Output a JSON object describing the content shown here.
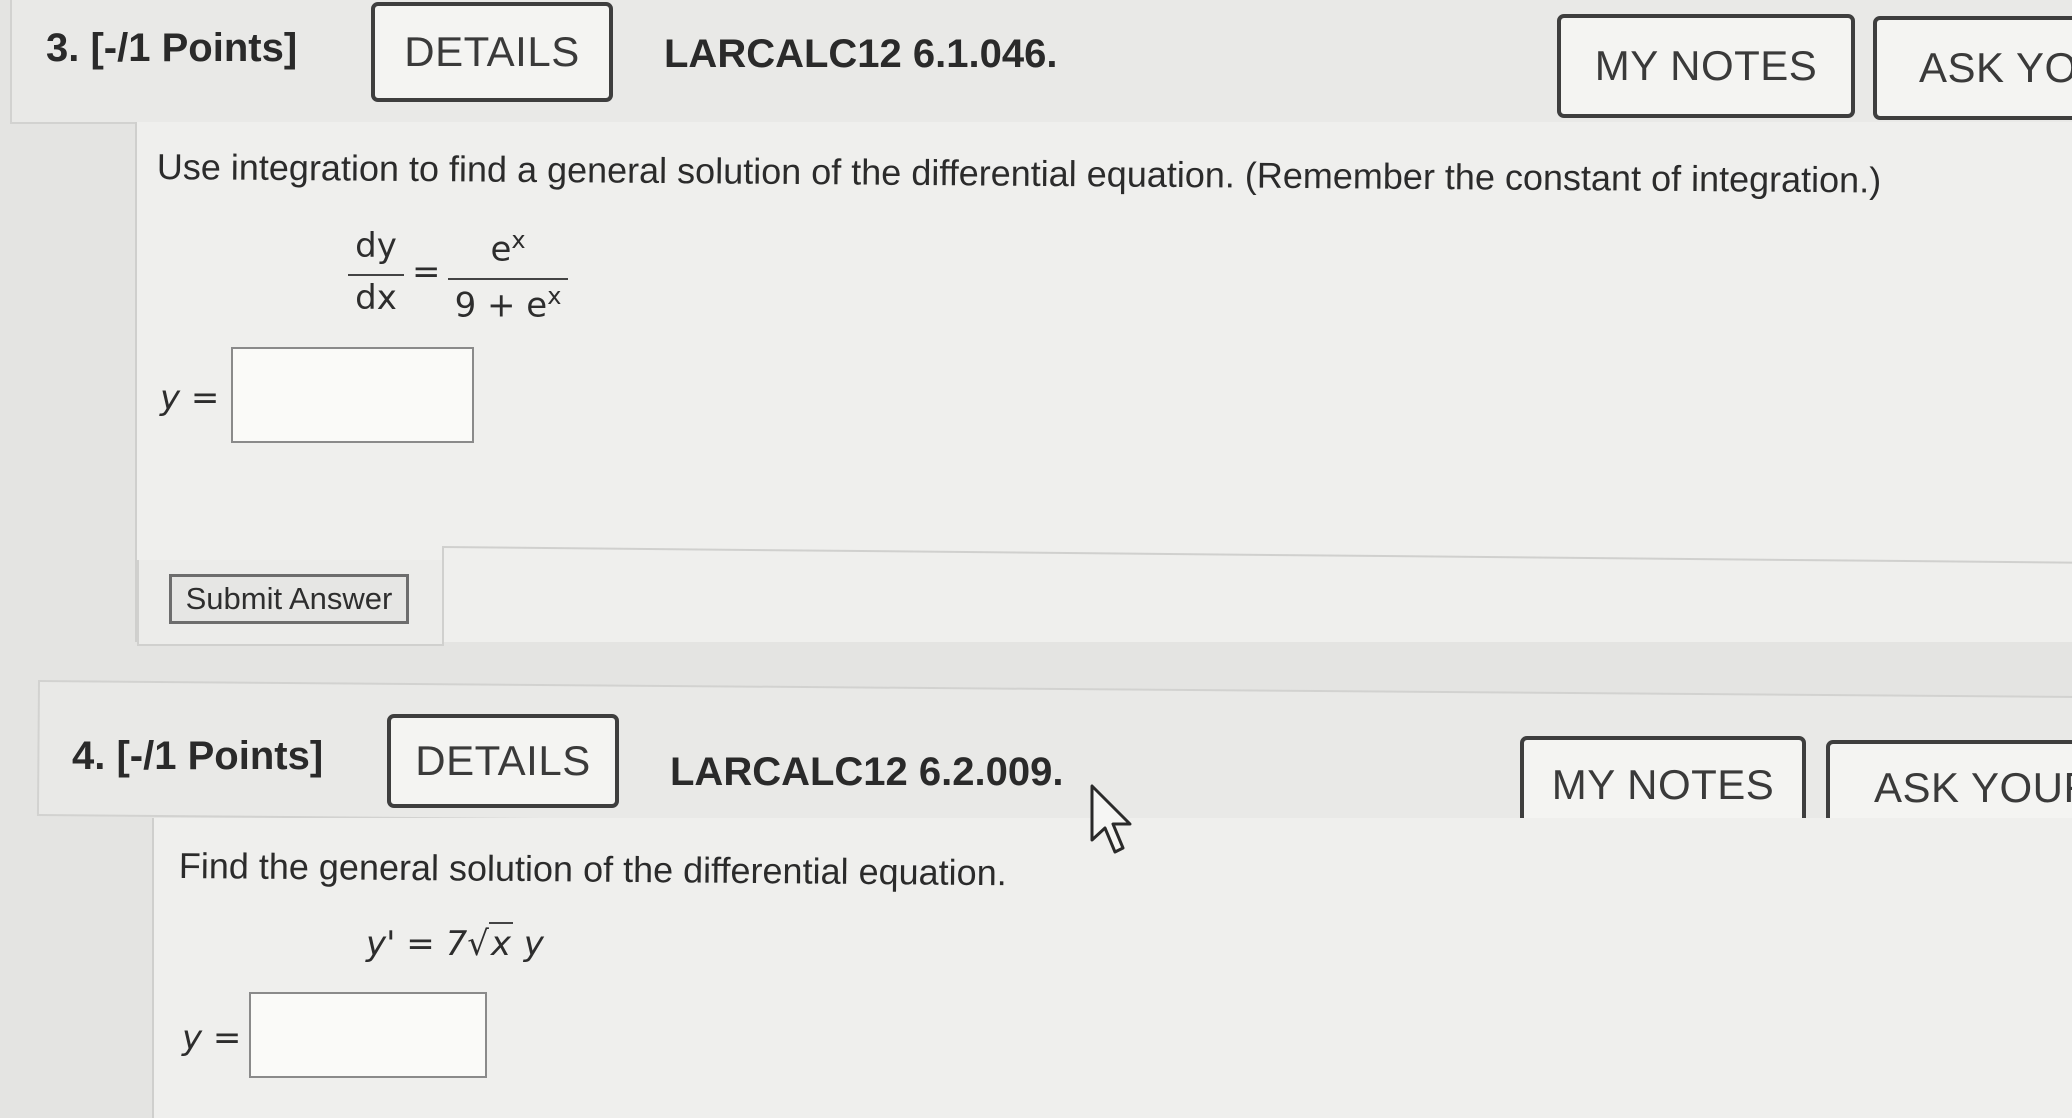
{
  "question3": {
    "number": "3.",
    "points": "[-/1 Points]",
    "details_label": "DETAILS",
    "reference": "LARCALC12 6.1.046.",
    "my_notes_label": "MY NOTES",
    "ask_label": "ASK YOUR TEACHER",
    "prompt": "Use integration to find a general solution of the differential equation. (Remember the constant of integration.)",
    "eq_lhs_num": "dy",
    "eq_lhs_den": "dx",
    "eq_equals": "=",
    "eq_rhs_num": "e",
    "eq_rhs_num_sup": "x",
    "eq_rhs_den": "9 + e",
    "eq_rhs_den_sup": "x",
    "answer_label": "y =",
    "answer_value": "",
    "submit_label": "Submit Answer"
  },
  "question4": {
    "number": "4.",
    "points": "[-/1 Points]",
    "details_label": "DETAILS",
    "reference": "LARCALC12 6.2.009.",
    "my_notes_label": "MY NOTES",
    "ask_label": "ASK YOUR TEACHER",
    "prompt": "Find the general solution of the differential equation.",
    "eq_lhs": "y' = 7",
    "eq_radicand": "x",
    "eq_tail": " y",
    "answer_label": "y =",
    "answer_value": ""
  },
  "colors": {
    "page_bg": "#e4e4e2",
    "header_bg": "#e9e9e7",
    "button_border": "#3e3e3e",
    "text": "#2a2a2a"
  }
}
